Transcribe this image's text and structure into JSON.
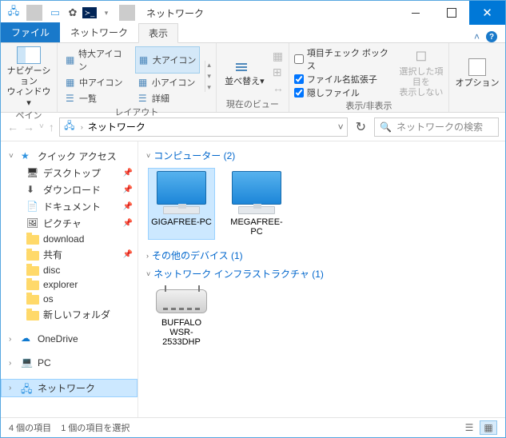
{
  "title": "ネットワーク",
  "tabs": {
    "file": "ファイル",
    "network": "ネットワーク",
    "view": "表示"
  },
  "ribbon": {
    "pane": {
      "label": "ペイン",
      "navpane": "ナビゲーション\nウィンドウ▾"
    },
    "layout": {
      "label": "レイアウト",
      "items": [
        "特大アイコン",
        "大アイコン",
        "中アイコン",
        "小アイコン",
        "一覧",
        "詳細"
      ]
    },
    "currentview": {
      "label": "現在のビュー",
      "sort": "並べ替え▾"
    },
    "showhide": {
      "label": "表示/非表示",
      "checkboxes": "項目チェック ボックス",
      "ext": "ファイル名拡張子",
      "hidden": "隠しファイル",
      "hideselected": "選択した項目を\n表示しない"
    },
    "options": "オプション"
  },
  "address": {
    "location": "ネットワーク"
  },
  "search": {
    "placeholder": "ネットワークの検索"
  },
  "sidebar": {
    "quick": "クイック アクセス",
    "desktop": "デスクトップ",
    "downloads": "ダウンロード",
    "documents": "ドキュメント",
    "pictures": "ピクチャ",
    "download_f": "download",
    "share": "共有",
    "disc": "disc",
    "explorer": "explorer",
    "os": "os",
    "newfolder": "新しいフォルダ",
    "onedrive": "OneDrive",
    "pc": "PC",
    "network": "ネットワーク"
  },
  "groups": {
    "computers": {
      "header": "コンピューター (2)",
      "items": [
        "GIGAFREE-PC",
        "MEGAFREE-PC"
      ]
    },
    "other": {
      "header": "その他のデバイス (1)"
    },
    "infra": {
      "header": "ネットワーク インフラストラクチャ (1)",
      "items": [
        "BUFFALO WSR-2533DHP"
      ]
    }
  },
  "status": {
    "count": "4 個の項目",
    "selection": "1 個の項目を選択"
  }
}
